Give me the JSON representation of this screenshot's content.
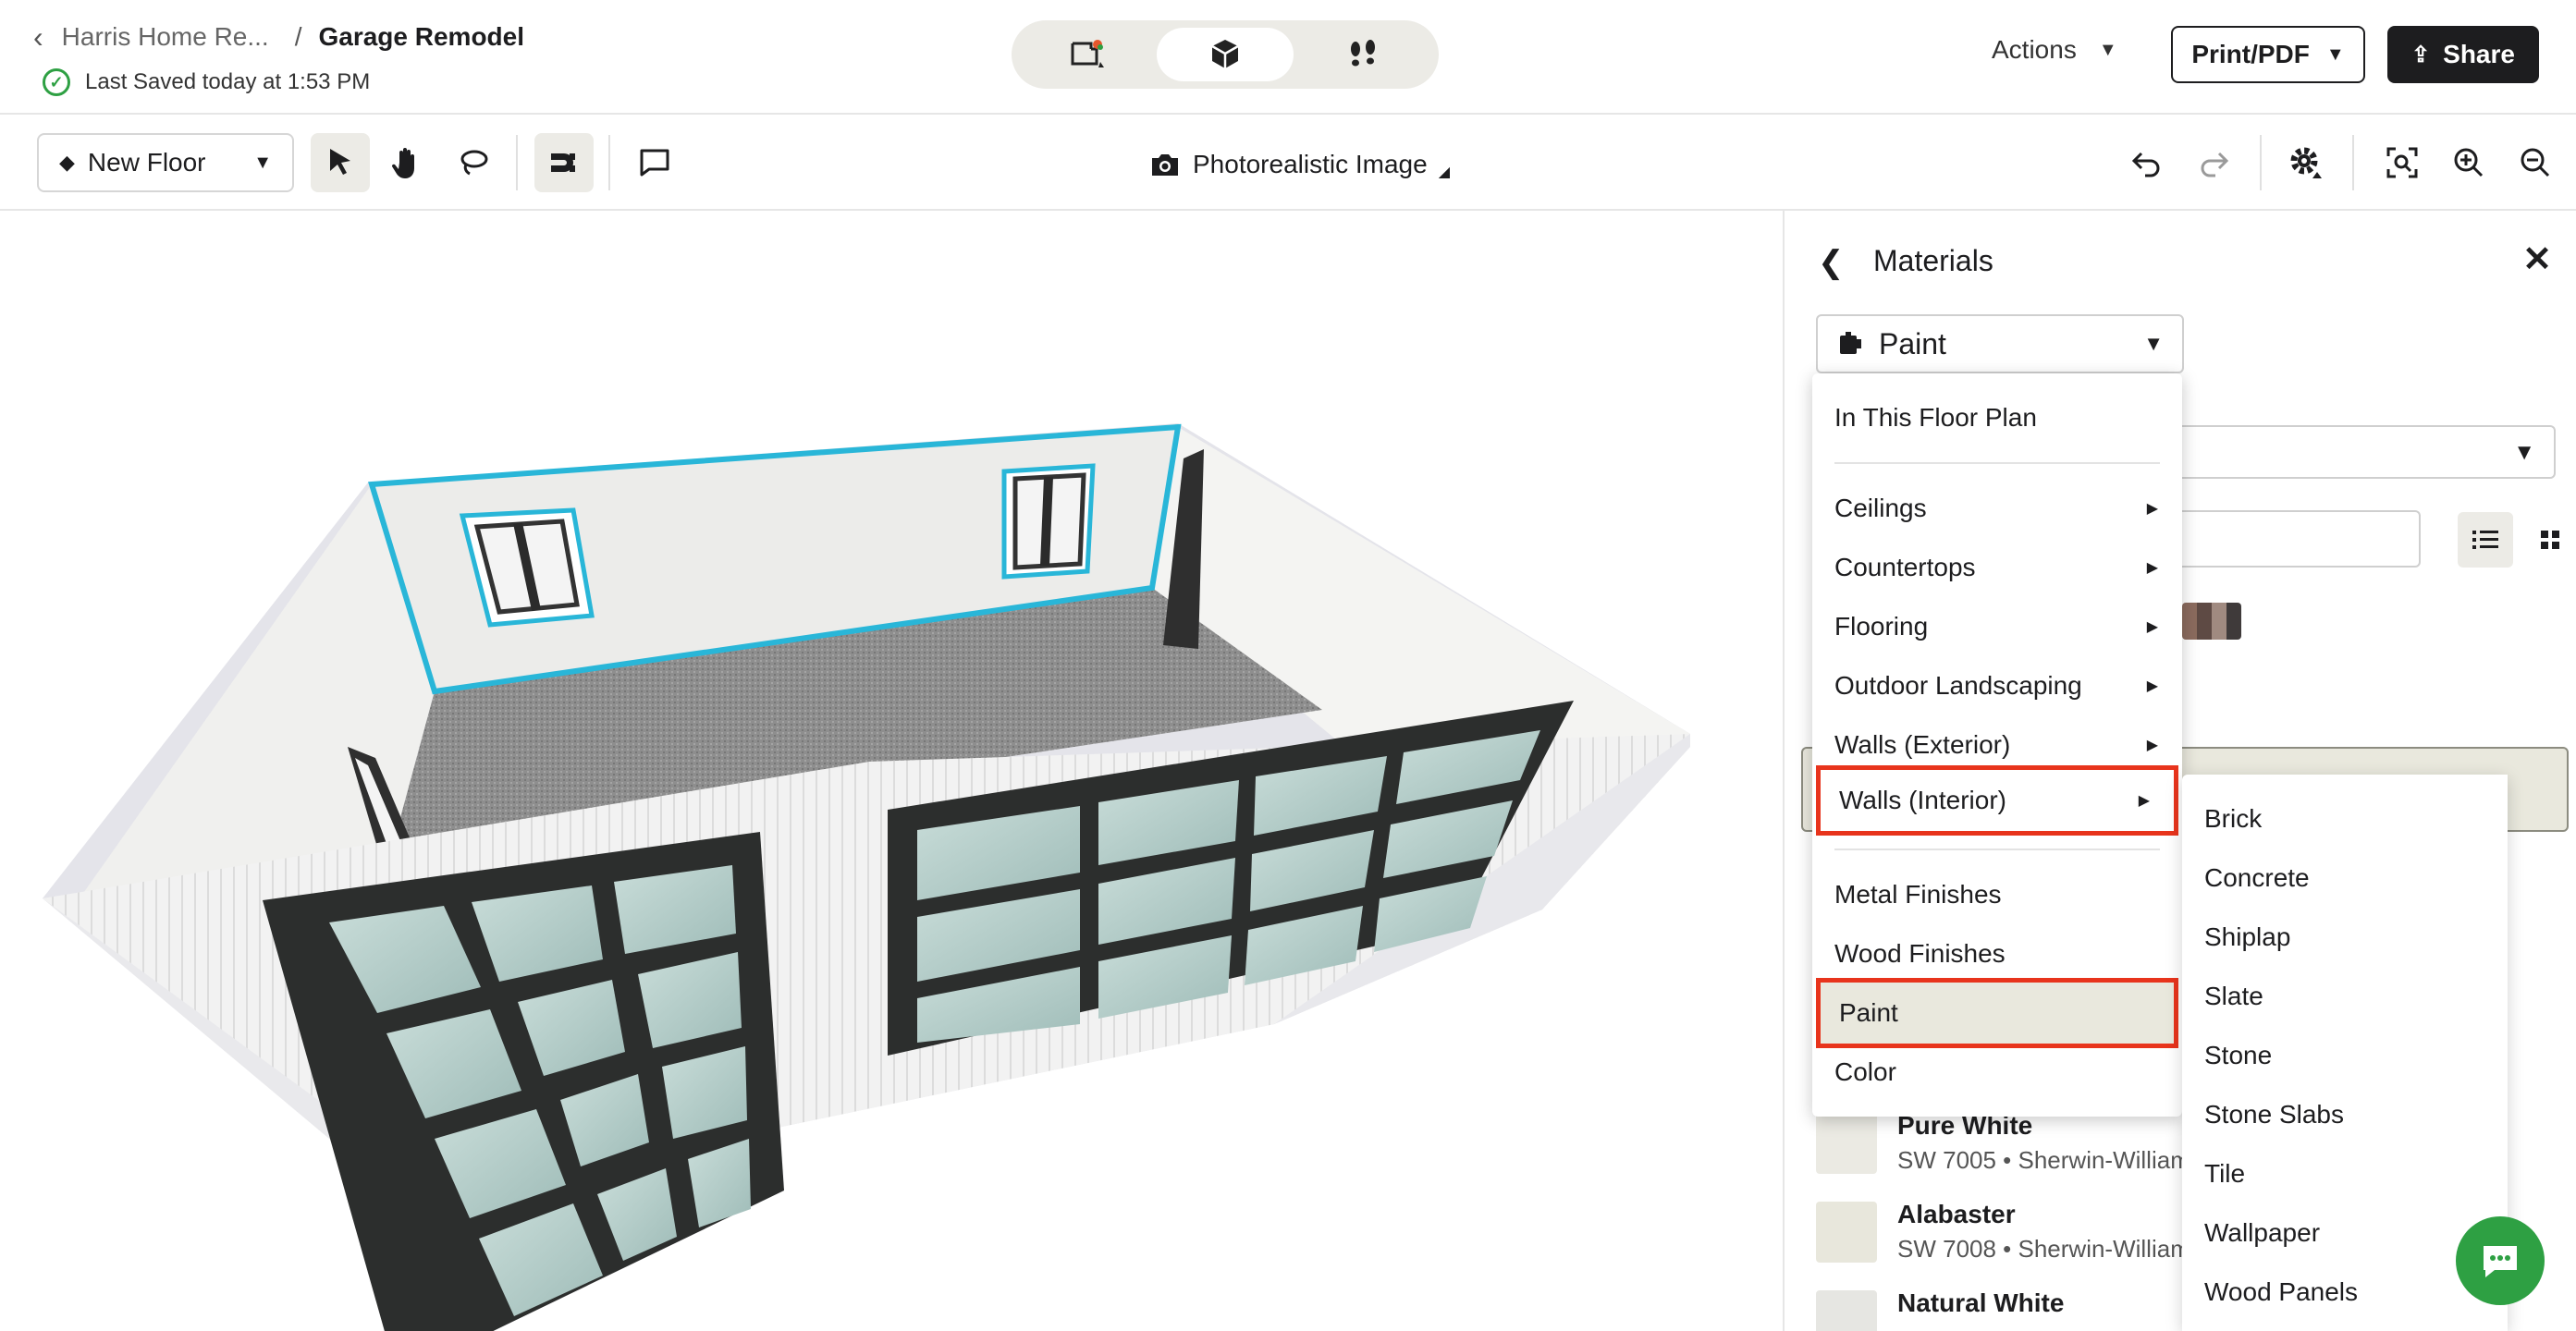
{
  "header": {
    "breadcrumb_parent": "Harris Home Re...",
    "breadcrumb_sep": "/",
    "breadcrumb_current": "Garage Remodel",
    "saved_text": "Last Saved today at 1:53 PM",
    "actions_label": "Actions",
    "print_label": "Print/PDF",
    "share_label": "Share"
  },
  "toolbar": {
    "floor_label": "New Floor",
    "photo_label": "Photorealistic Image"
  },
  "panel": {
    "title": "Materials",
    "category_selected": "Paint",
    "results": [
      {
        "name": "Pure White",
        "code": "SW 7005 • Sherwin-Williams",
        "color": "#ebeae3"
      },
      {
        "name": "Alabaster",
        "code": "SW 7008 • Sherwin-Williams",
        "color": "#e8e7dc"
      },
      {
        "name": "Natural White",
        "color": "#e6e6e2"
      }
    ]
  },
  "menu": {
    "items": [
      {
        "label": "In This Floor Plan"
      },
      {
        "label": "Ceilings"
      },
      {
        "label": "Countertops"
      },
      {
        "label": "Flooring"
      },
      {
        "label": "Outdoor Landscaping"
      },
      {
        "label": "Walls (Exterior)"
      },
      {
        "label": "Walls (Interior)"
      },
      {
        "label": "Metal Finishes"
      },
      {
        "label": "Wood Finishes"
      },
      {
        "label": "Paint"
      },
      {
        "label": "Color"
      }
    ],
    "submenu": [
      "Brick",
      "Concrete",
      "Shiplap",
      "Slate",
      "Stone",
      "Stone Slabs",
      "Tile",
      "Wallpaper",
      "Wood Panels"
    ]
  },
  "colors": {
    "highlight": "#e8341c",
    "accent_green": "#2ea043",
    "selection_cyan": "#29b6d8",
    "dark": "#1d1d1f"
  }
}
